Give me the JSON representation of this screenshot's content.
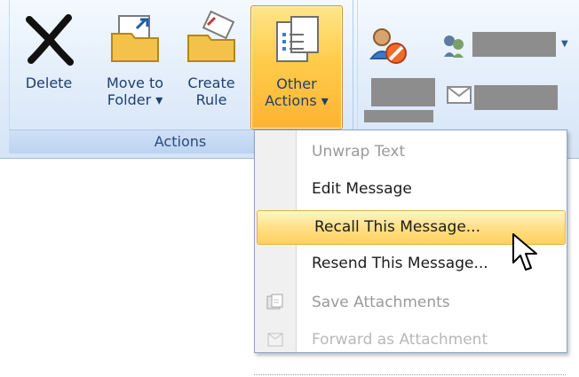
{
  "ribbon": {
    "group_label": "Actions",
    "buttons": [
      {
        "id": "delete",
        "line1": "Delete",
        "line2": ""
      },
      {
        "id": "move",
        "line1": "Move to",
        "line2": "Folder ▾"
      },
      {
        "id": "create",
        "line1": "Create",
        "line2": "Rule"
      },
      {
        "id": "other",
        "line1": "Other",
        "line2": "Actions ▾"
      }
    ]
  },
  "menu": {
    "items": [
      {
        "label": "Unwrap Text",
        "state": "disabled"
      },
      {
        "label": "Edit Message",
        "state": "enabled"
      },
      {
        "label": "Recall This Message...",
        "state": "highlight"
      },
      {
        "label": "Resend This Message...",
        "state": "enabled"
      },
      {
        "label": "Save Attachments",
        "state": "disabled"
      },
      {
        "label": "Forward as Attachment",
        "state": "faded"
      }
    ]
  },
  "icons": {
    "delete": "delete-x-icon",
    "move": "move-folder-icon",
    "create": "create-rule-icon",
    "other": "other-actions-icon",
    "block": "block-sender-icon",
    "people": "people-icon",
    "save": "save-attachments-icon",
    "forward": "forward-attachment-icon",
    "cursor": "mouse-pointer-icon"
  },
  "colors": {
    "ribbon_text": "#1f3f6f",
    "highlight": "#ffd15f",
    "active_button": "#ffcc4a"
  }
}
